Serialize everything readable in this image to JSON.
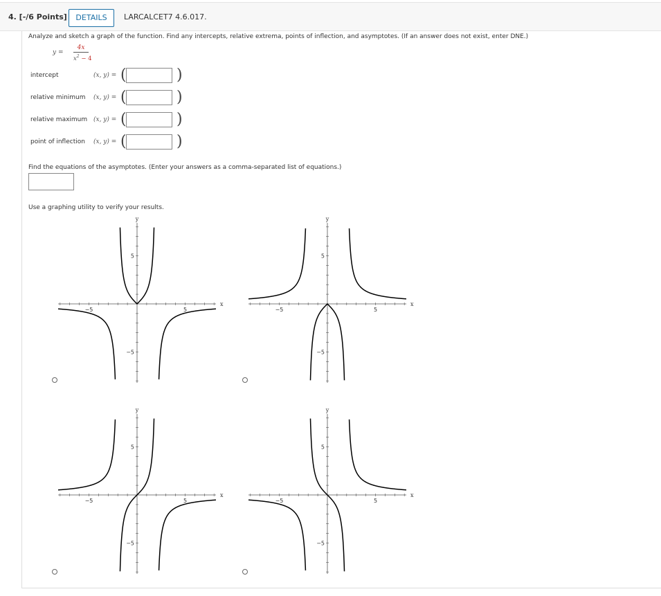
{
  "header": {
    "question_number": "4.  [-/6 Points]",
    "details_label": "DETAILS",
    "question_code": "LARCALCET7 4.6.017."
  },
  "prompt": "Analyze and sketch a graph of the function. Find any intercepts, relative extrema, points of inflection, and asymptotes. (If an answer does not exist, enter DNE.)",
  "formula": {
    "lhs": "y =",
    "numerator": "4x",
    "denominator_var": "x",
    "denominator_exp": "2",
    "denominator_rest": " − 4"
  },
  "rows": [
    {
      "label": "intercept",
      "xy": "(x, y) =",
      "value": ""
    },
    {
      "label": "relative minimum",
      "xy": "(x, y) =",
      "value": ""
    },
    {
      "label": "relative maximum",
      "xy": "(x, y) =",
      "value": ""
    },
    {
      "label": "point of inflection",
      "xy": "(x, y) =",
      "value": ""
    }
  ],
  "paren_open": "(",
  "paren_close": ")",
  "asymptote_prompt": "Find the equations of the asymptotes. (Enter your answers as a comma-separated list of equations.)",
  "asymptote_value": "",
  "verify_text": "Use a graphing utility to verify your results.",
  "graph_labels": {
    "y": "y",
    "x": "x",
    "tick_pos": "5",
    "tick_neg": "−5"
  },
  "graph_options": [
    {
      "id": "a",
      "selected": false
    },
    {
      "id": "b",
      "selected": false
    },
    {
      "id": "c",
      "selected": false
    },
    {
      "id": "d",
      "selected": false
    }
  ],
  "colors": {
    "accent": "#1a6fa6",
    "formula_red": "#c4302b",
    "curve": "#000000",
    "axis": "#555555"
  }
}
